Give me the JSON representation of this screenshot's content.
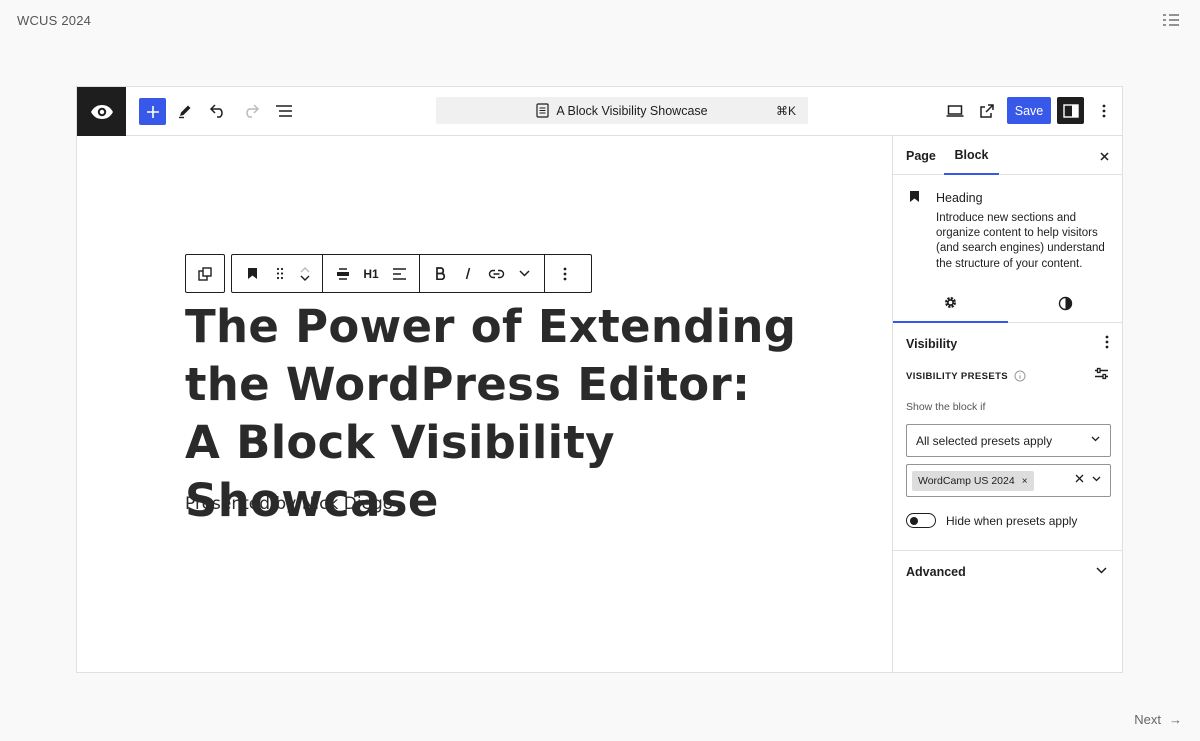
{
  "deck": {
    "title": "WCUS 2024",
    "next_label": "Next",
    "next_arrow": "→"
  },
  "topbar": {
    "command_title": "A Block Visibility Showcase",
    "command_shortcut": "⌘K",
    "save_label": "Save"
  },
  "block_toolbar": {
    "heading_level": "H1"
  },
  "canvas": {
    "heading_lines": [
      "The Power of Extending",
      "the WordPress Editor:",
      "A Block Visibility Showcase"
    ],
    "presented_by": "Presented by Nick Diego"
  },
  "sidebar": {
    "tabs": {
      "page": "Page",
      "block": "Block"
    },
    "block_card": {
      "title": "Heading",
      "description": "Introduce new sections and organize content to help visitors (and search engines) understand the structure of your content."
    },
    "visibility": {
      "title": "Visibility",
      "presets_label": "VISIBILITY PRESETS",
      "show_label": "Show the block if",
      "condition_value": "All selected presets apply",
      "token": "WordCamp US 2024",
      "token_remove": "×",
      "clear_symbol": "×",
      "toggle_label": "Hide when presets apply"
    },
    "advanced": {
      "title": "Advanced"
    }
  },
  "colors": {
    "accent": "#3858e9",
    "dark": "#1e1e1e",
    "border": "#e0e0e0"
  }
}
